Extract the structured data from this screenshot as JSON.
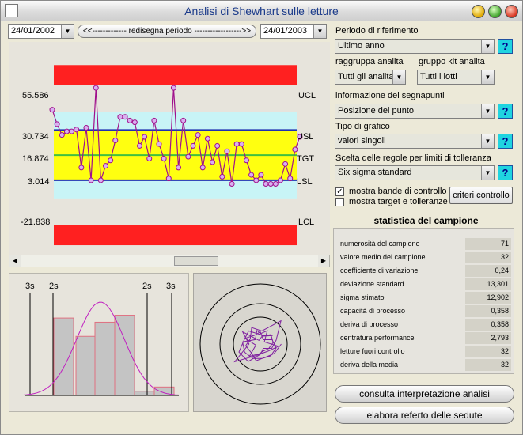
{
  "window": {
    "title": "Analisi di Shewhart sulle letture"
  },
  "toolbar": {
    "date_from": "24/01/2002",
    "date_to": "24/01/2003",
    "period_button": "<<-------------   redisegna periodo   ------------------>>"
  },
  "control_chart": {
    "ucl_value": "55.586",
    "usl_value": "30.734",
    "tgt_value": "16.874",
    "lsl_value": "3.014",
    "lcl_value": "-21.838",
    "ucl_label": "UCL",
    "usl_label": "USL",
    "tgt_label": "TGT",
    "lsl_label": "LSL",
    "lcl_label": "LCL"
  },
  "chart_data": {
    "type": "line",
    "ylim": [
      -35,
      75
    ],
    "reference_lines": {
      "UCL": 55.586,
      "USL": 30.734,
      "TGT": 16.874,
      "LSL": 3.014,
      "LCL": -21.838
    },
    "values": [
      42,
      34,
      28,
      30,
      30,
      31,
      10,
      32,
      3,
      54,
      3,
      11,
      14,
      25,
      38,
      38,
      36,
      35,
      22,
      27,
      15,
      36,
      23,
      15,
      4,
      54,
      10,
      36,
      16,
      22,
      28,
      10,
      26,
      13,
      22,
      5,
      19,
      1,
      23,
      23,
      14,
      6,
      3,
      6,
      1,
      1,
      1,
      3,
      12,
      4,
      20,
      27
    ]
  },
  "histogram": {
    "labels": {
      "left3s": "3s",
      "left2s": "2s",
      "right2s": "2s",
      "right3s": "3s"
    },
    "bins": [
      0.55,
      0.42,
      0.52,
      0.57,
      0.03,
      0.06
    ]
  },
  "right_panel": {
    "period_label": "Periodo di riferimento",
    "period_value": "Ultimo anno",
    "group_analyte_label": "raggruppa analita",
    "group_analyte_value": "Tutti gli analita",
    "group_kit_label": "gruppo kit analita",
    "group_kit_value": "Tutti i lotti",
    "scorer_label": "informazione dei segnapunti",
    "scorer_value": "Posizione del punto",
    "chart_type_label": "Tipo di grafico",
    "chart_type_value": "valori singoli",
    "rules_label": "Scelta delle regole per limiti di tolleranza",
    "rules_value": "Six sigma standard",
    "show_bands_label": "mostra bande di controllo",
    "show_target_label": "mostra target e tolleranze",
    "criteria_button": "criteri controllo",
    "help_glyph": "?"
  },
  "stats": {
    "title": "statistica del campione",
    "rows": [
      {
        "label": "numerosità del campione",
        "value": "71"
      },
      {
        "label": "valore medio del campione",
        "value": "32"
      },
      {
        "label": "coefficiente di variazione",
        "value": "0,24"
      },
      {
        "label": "deviazione standard",
        "value": "13,301"
      },
      {
        "label": "sigma stimato",
        "value": "12,902"
      },
      {
        "label": "capacità di processo",
        "value": "0,358"
      },
      {
        "label": "deriva di processo",
        "value": "0,358"
      },
      {
        "label": "centratura performance",
        "value": "2,793"
      },
      {
        "label": "letture fuori controllo",
        "value": "32"
      },
      {
        "label": "deriva della media",
        "value": "32"
      }
    ]
  },
  "actions": {
    "interpret_button": "consulta interpretazione analisi",
    "report_button": "elabora referto delle sedute"
  },
  "colors": {
    "control_band": "#ff2020",
    "tolerance_band": "#c8f4f6",
    "target_band": "#ffff10",
    "spec_line": "#2030b0",
    "target_line": "#40c040",
    "series_line": "#a0108c",
    "point_fill": "#d8b0f0"
  }
}
